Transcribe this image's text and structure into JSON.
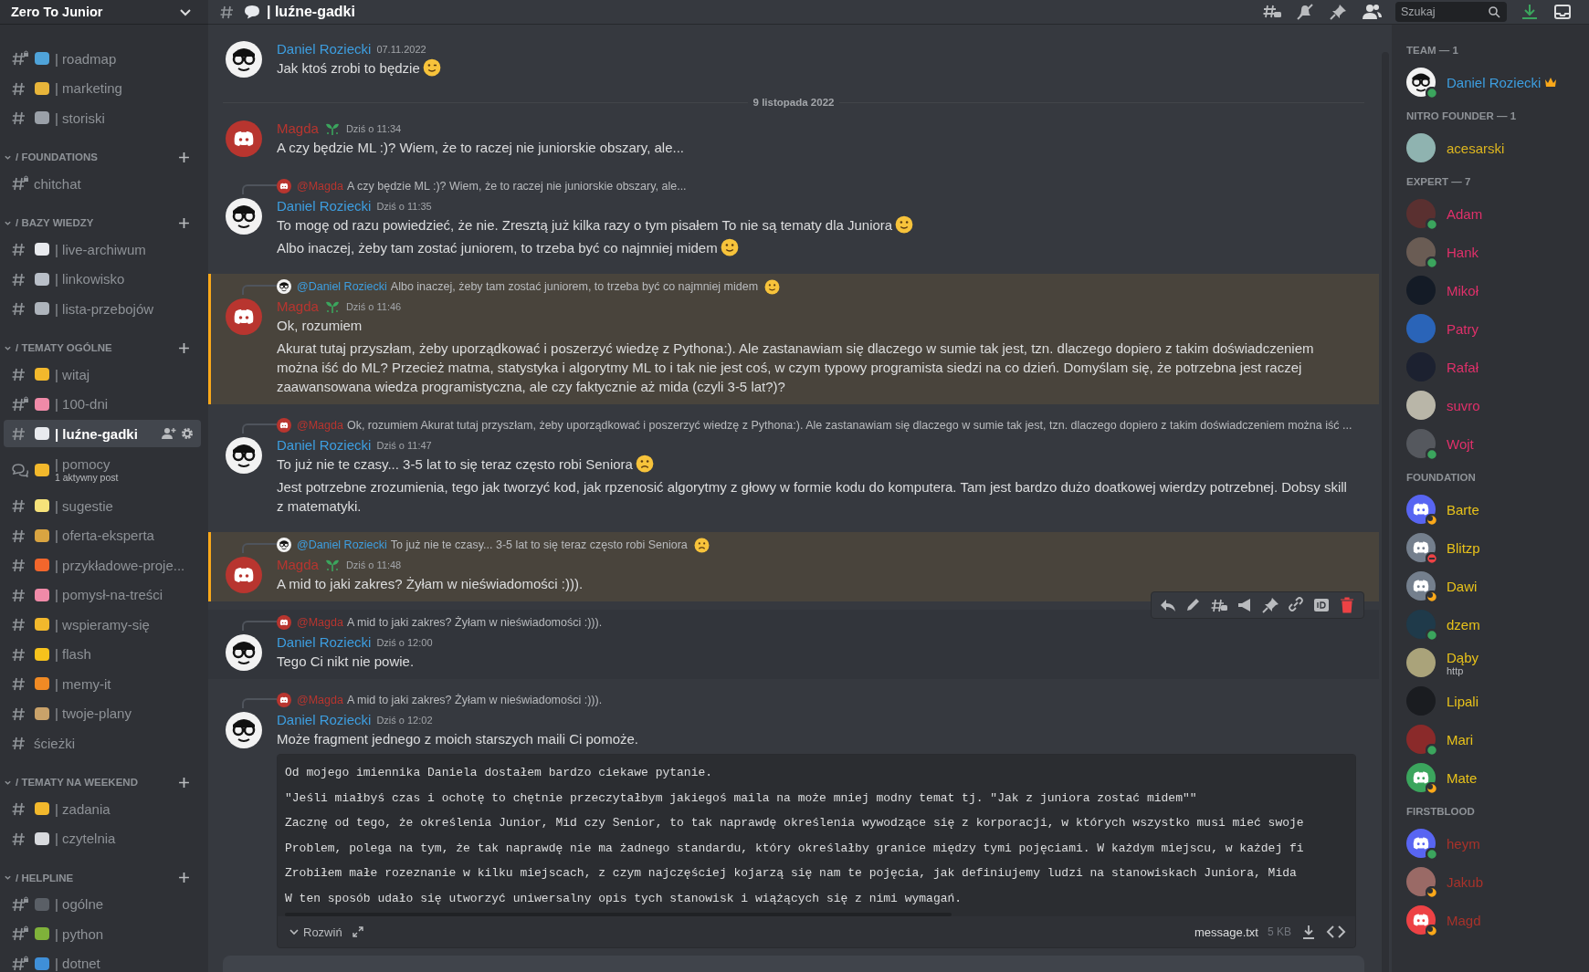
{
  "server": {
    "name": "Zero To Junior"
  },
  "sidebar": {
    "sections": [
      {
        "expanded": true,
        "channels": [
          {
            "name": "| roadmap",
            "kind": "locked",
            "color": "#4fa3d9",
            "selected": false
          },
          {
            "name": "| marketing",
            "kind": "text",
            "color": "#e8b53a",
            "selected": false
          },
          {
            "name": "| storiski",
            "kind": "text",
            "color": "#9aa0a8",
            "selected": false
          }
        ]
      },
      {
        "title": "/ FOUNDATIONS",
        "expanded": true,
        "channels": [
          {
            "name": "chitchat",
            "kind": "locked",
            "selected": false
          }
        ]
      },
      {
        "title": "/ BAZY WIEDZY",
        "expanded": true,
        "channels": [
          {
            "name": "| live-archiwum",
            "kind": "text",
            "color": "#e8eaee",
            "selected": false
          },
          {
            "name": "| linkowisko",
            "kind": "text",
            "color": "#b9bfc8",
            "selected": false
          },
          {
            "name": "| lista-przebojów",
            "kind": "text",
            "color": "#aeb4bc",
            "selected": false
          }
        ]
      },
      {
        "title": "/ TEMATY OGÓLNE",
        "expanded": true,
        "channels": [
          {
            "name": "| witaj",
            "kind": "text",
            "color": "#f2b82c",
            "selected": false
          },
          {
            "name": "| 100-dni",
            "kind": "locked",
            "color": "#f08aa8",
            "selected": false
          },
          {
            "name": "| luźne-gadki",
            "kind": "text",
            "color": "#e8eaee",
            "selected": true
          },
          {
            "name": "| pomocy",
            "kind": "forum",
            "color": "#f2b82c",
            "subtitle": "1 aktywny post",
            "selected": false
          },
          {
            "name": "| sugestie",
            "kind": "text",
            "color": "#f6e27a",
            "selected": false
          },
          {
            "name": "| oferta-eksperta",
            "kind": "text",
            "color": "#d9a441",
            "selected": false
          },
          {
            "name": "| przykładowe-proje...",
            "kind": "text",
            "color": "#f2662c",
            "selected": false
          },
          {
            "name": "| pomysł-na-treści",
            "kind": "text",
            "color": "#f08aa8",
            "selected": false
          },
          {
            "name": "| wspieramy-się",
            "kind": "text",
            "color": "#f2b82c",
            "selected": false
          },
          {
            "name": "| flash",
            "kind": "text",
            "color": "#f6c21c",
            "selected": false
          },
          {
            "name": "| memy-it",
            "kind": "text",
            "color": "#f08a24",
            "selected": false
          },
          {
            "name": "| twoje-plany",
            "kind": "text",
            "color": "#c9a26a",
            "selected": false
          },
          {
            "name": "ścieżki",
            "kind": "text",
            "selected": false
          }
        ]
      },
      {
        "title": "/ TEMATY NA WEEKEND",
        "expanded": true,
        "channels": [
          {
            "name": "| zadania",
            "kind": "text",
            "color": "#f2b82c",
            "selected": false
          },
          {
            "name": "| czytelnia",
            "kind": "text",
            "color": "#d8dade",
            "selected": false
          }
        ]
      },
      {
        "title": "/ HELPLINE",
        "expanded": true,
        "channels": [
          {
            "name": "| ogólne",
            "kind": "locked",
            "color": "#5a5f66",
            "selected": false
          },
          {
            "name": "| python",
            "kind": "locked",
            "color": "#7fb23a",
            "selected": false
          },
          {
            "name": "| dotnet",
            "kind": "locked",
            "color": "#3f8fd8",
            "selected": false
          }
        ]
      }
    ]
  },
  "header": {
    "channel": "| luźne-gadki",
    "search": {
      "placeholder": "Szukaj"
    }
  },
  "messages": [
    {
      "kind": "message",
      "author": "Daniel Roziecki",
      "color": "#3d9ee0",
      "avatar": {
        "kind": "glasses"
      },
      "time": "07.11.2022",
      "role_icon": false,
      "highlighted": false,
      "hovered": false,
      "lines": [
        {
          "text": "Jak ktoś zrobi to będzie",
          "emoji": {
            "kind": "wink"
          }
        }
      ]
    },
    {
      "kind": "divider",
      "text": "9 listopada 2022"
    },
    {
      "kind": "message",
      "author": "Magda",
      "color": "#b8352f",
      "avatar": {
        "kind": "discord"
      },
      "time": "Dziś o 11:34",
      "role_icon": true,
      "highlighted": false,
      "hovered": false,
      "lines": [
        {
          "text": "A czy będzie ML :)? Wiem, że to raczej nie juniorskie obszary, ale..."
        }
      ]
    },
    {
      "kind": "message",
      "reply": {
        "author": "@Magda",
        "color": "#b8352f",
        "avatar": {
          "kind": "discord"
        },
        "text": "A czy będzie ML :)? Wiem, że to raczej nie juniorskie obszary, ale..."
      },
      "author": "Daniel Roziecki",
      "color": "#3d9ee0",
      "avatar": {
        "kind": "glasses"
      },
      "time": "Dziś o 11:35",
      "role_icon": false,
      "highlighted": false,
      "hovered": false,
      "lines": [
        {
          "text": "To mogę od razu powiedzieć, że nie. Zresztą już kilka razy o tym pisałem To nie są tematy dla Juniora",
          "emoji": {
            "kind": "smile"
          }
        },
        {
          "text": "Albo inaczej, żeby tam zostać juniorem, to trzeba być co najmniej midem",
          "emoji": {
            "kind": "smile"
          }
        }
      ]
    },
    {
      "kind": "message",
      "reply": {
        "author": "@Daniel Roziecki",
        "color": "#3d9ee0",
        "avatar": {
          "kind": "glasses"
        },
        "text": "Albo inaczej, żeby tam zostać juniorem, to trzeba być co najmniej midem",
        "emoji": {
          "kind": "smile"
        }
      },
      "author": "Magda",
      "color": "#b8352f",
      "avatar": {
        "kind": "discord"
      },
      "time": "Dziś o 11:46",
      "role_icon": true,
      "highlighted": true,
      "hovered": false,
      "lines": [
        {
          "text": "Ok, rozumiem"
        },
        {
          "text": "Akurat tutaj przyszłam, żeby uporządkować i poszerzyć wiedzę z Pythona:).  Ale zastanawiam się dlaczego w sumie tak jest, tzn. dlaczego dopiero z takim doświadczeniem można iść do ML? Przecież matma, statystyka i algorytmy ML to i tak nie jest coś, w czym typowy programista siedzi na co dzień. Domyślam się, że potrzebna jest raczej zaawansowana wiedza programistyczna, ale czy faktycznie aż mida (czyli 3-5 lat?)?"
        }
      ]
    },
    {
      "kind": "message",
      "reply": {
        "author": "@Magda",
        "color": "#b8352f",
        "avatar": {
          "kind": "discord"
        },
        "text": "Ok, rozumiem  Akurat tutaj przyszłam, żeby uporządkować i poszerzyć wiedzę z Pythona:).  Ale zastanawiam się dlaczego w sumie tak jest, tzn. dlaczego dopiero z takim doświadczeniem można iść ..."
      },
      "author": "Daniel Roziecki",
      "color": "#3d9ee0",
      "avatar": {
        "kind": "glasses"
      },
      "time": "Dziś o 11:47",
      "role_icon": false,
      "highlighted": false,
      "hovered": false,
      "lines": [
        {
          "text": "To już nie te czasy... 3-5 lat to się teraz często robi Seniora",
          "emoji": {
            "kind": "frown"
          }
        },
        {
          "text": "Jest potrzebne zrozumienia, tego jak tworzyć kod, jak rpzenosić algorytmy z głowy w formie kodu do komputera. Tam jest bardzo dużo doatkowej wierdzy potrzebnej. Dobsy skill z matematyki."
        }
      ]
    },
    {
      "kind": "message",
      "reply": {
        "author": "@Daniel Roziecki",
        "color": "#3d9ee0",
        "avatar": {
          "kind": "glasses"
        },
        "text": "To już nie te czasy... 3-5 lat to się teraz często robi Seniora",
        "emoji": {
          "kind": "frown"
        }
      },
      "author": "Magda",
      "color": "#b8352f",
      "avatar": {
        "kind": "discord"
      },
      "time": "Dziś o 11:48",
      "role_icon": true,
      "highlighted": true,
      "hovered": false,
      "lines": [
        {
          "text": "A mid to jaki zakres? Żyłam w nieświadomości :)))."
        }
      ]
    },
    {
      "kind": "message",
      "reply": {
        "author": "@Magda",
        "color": "#b8352f",
        "avatar": {
          "kind": "discord"
        },
        "text": "A mid to jaki zakres? Żyłam w nieświadomości :)))."
      },
      "author": "Daniel Roziecki",
      "color": "#3d9ee0",
      "avatar": {
        "kind": "glasses"
      },
      "time": "Dziś o 12:00",
      "role_icon": false,
      "highlighted": false,
      "hovered": true,
      "lines": [
        {
          "text": "Tego Ci nikt nie powie."
        }
      ]
    },
    {
      "kind": "message",
      "reply": {
        "author": "@Magda",
        "color": "#b8352f",
        "avatar": {
          "kind": "discord"
        },
        "text": "A mid to jaki zakres? Żyłam w nieświadomości :)))."
      },
      "author": "Daniel Roziecki",
      "color": "#3d9ee0",
      "avatar": {
        "kind": "glasses"
      },
      "time": "Dziś o 12:02",
      "role_icon": false,
      "highlighted": false,
      "hovered": false,
      "lines": [
        {
          "text": "Może fragment jednego z moich starszych maili Ci pomoże."
        }
      ],
      "attachment": {
        "lines": [
          "Od mojego imiennika Daniela dostałem bardzo ciekawe pytanie.",
          "\"Jeśli miałbyś czas i ochotę to chętnie przeczytałbym jakiegoś maila na może mniej modny temat tj. \"Jak z juniora zostać midem\"\"",
          "Zacznę od tego, że określenia Junior, Mid czy Senior, to tak naprawdę określenia wywodzące się z korporacji, w których wszystko musi mieć swoje",
          "Problem, polega na tym, że tak naprawdę nie ma żadnego standardu, który określałby granice między tymi pojęciami. W każdym miejscu, w każdej fi",
          "Zrobiłem małe rozeznanie w kilku miejscach, z czym najczęściej kojarzą się nam te pojęcia, jak definiujemy ludzi na stanowiskach Juniora, Mida",
          "W ten sposób udało się utworzyć uniwersalny opis tych stanowisk i wiążących się z nimi wymagań."
        ],
        "toggle": "Rozwiń",
        "filename": "message.txt",
        "size": "5 KB"
      }
    }
  ],
  "members": {
    "groups": [
      {
        "title": "TEAM — 1",
        "color": "#3d9ee0",
        "members": [
          {
            "name": "Daniel Roziecki",
            "avatar": {
              "kind": "glasses"
            },
            "status": {
              "kind": "online"
            },
            "owner": true
          }
        ]
      },
      {
        "title": "NITRO FOUNDER — 1",
        "color": "#dcb51f",
        "members": [
          {
            "name": "acesarski",
            "avatar": {
              "kind": "photo"
            },
            "color": "#8fb3b0",
            "owner": false
          }
        ]
      },
      {
        "title": "EXPERT — 7",
        "color": "#e0306a",
        "members": [
          {
            "name": "Adam",
            "avatar": {
              "kind": "photo"
            },
            "color": "#5a3030",
            "status": {
              "kind": "online"
            },
            "owner": false
          },
          {
            "name": "Hank",
            "avatar": {
              "kind": "photo"
            },
            "color": "#6a5c54",
            "status": {
              "kind": "online"
            },
            "owner": false
          },
          {
            "name": "Mikoł",
            "avatar": {
              "kind": "photo"
            },
            "color": "#141b26",
            "owner": false
          },
          {
            "name": "Patry",
            "avatar": {
              "kind": "photo"
            },
            "color": "#2a64b8",
            "owner": false
          },
          {
            "name": "Rafał",
            "avatar": {
              "kind": "photo"
            },
            "color": "#1c2130",
            "owner": false
          },
          {
            "name": "suvro",
            "avatar": {
              "kind": "photo"
            },
            "color": "#b9b6a8",
            "owner": false
          },
          {
            "name": "Wojt",
            "avatar": {
              "kind": "photo"
            },
            "color": "#55585e",
            "status": {
              "kind": "online"
            },
            "owner": false
          }
        ]
      },
      {
        "title": "FOUNDATION",
        "color": "#e8c21a",
        "members": [
          {
            "name": "Barte",
            "avatar": {
              "kind": "discord"
            },
            "color": "#5865f2",
            "status": {
              "kind": "idle"
            },
            "owner": false
          },
          {
            "name": "Blitzp",
            "avatar": {
              "kind": "discord"
            },
            "color": "#747f8d",
            "status": {
              "kind": "dnd"
            },
            "owner": false
          },
          {
            "name": "Dawi",
            "avatar": {
              "kind": "discord"
            },
            "color": "#747f8d",
            "status": {
              "kind": "idle"
            },
            "owner": false
          },
          {
            "name": "dzem",
            "avatar": {
              "kind": "photo"
            },
            "color": "#1f3a4a",
            "status": {
              "kind": "online"
            },
            "owner": false
          },
          {
            "name": "Dąby",
            "avatar": {
              "kind": "photo"
            },
            "color": "#aaa37a",
            "activity": "http",
            "owner": false
          },
          {
            "name": "Lipali",
            "avatar": {
              "kind": "photo"
            },
            "color": "#1a1c20",
            "owner": false
          },
          {
            "name": "Mari",
            "avatar": {
              "kind": "photo"
            },
            "color": "#8a2a2a",
            "status": {
              "kind": "online"
            },
            "owner": false
          },
          {
            "name": "Mate",
            "avatar": {
              "kind": "discord"
            },
            "color": "#3ba55d",
            "status": {
              "kind": "idle"
            },
            "owner": false
          }
        ]
      },
      {
        "title": "FIRSTBLOOD",
        "color": "#a8322a",
        "members": [
          {
            "name": "heym",
            "avatar": {
              "kind": "discord"
            },
            "color": "#5865f2",
            "status": {
              "kind": "online"
            },
            "owner": false
          },
          {
            "name": "Jakub",
            "avatar": {
              "kind": "photo"
            },
            "color": "#9a6a66",
            "status": {
              "kind": "idle"
            },
            "owner": false
          },
          {
            "name": "Magd",
            "avatar": {
              "kind": "discord"
            },
            "color": "#ed4245",
            "status": {
              "kind": "idle"
            },
            "owner": false
          }
        ]
      }
    ]
  }
}
